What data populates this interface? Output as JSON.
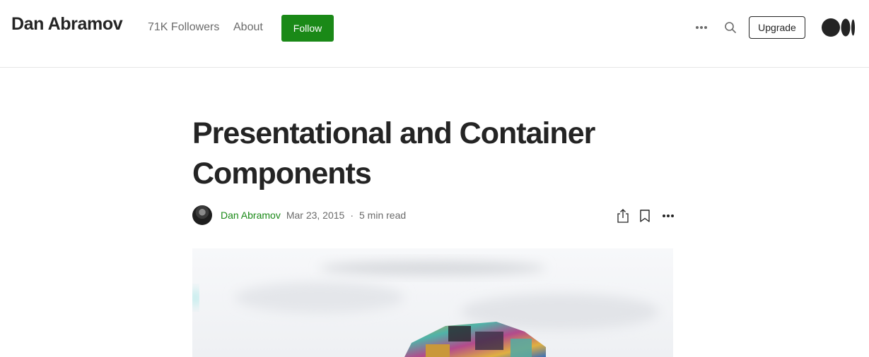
{
  "header": {
    "brand": "Dan Abramov",
    "followers": "71K Followers",
    "about": "About",
    "follow_label": "Follow",
    "more_icon": "more-horizontal-icon",
    "search_icon": "search-icon",
    "upgrade_label": "Upgrade",
    "logo_icon": "medium-logo-icon"
  },
  "article": {
    "title": "Presentational and Container Components",
    "author": "Dan Abramov",
    "date": "Mar 23, 2015",
    "separator": "·",
    "read_time": "5 min read",
    "actions": [
      "share-icon",
      "bookmark-icon",
      "more-options-icon"
    ]
  },
  "colors": {
    "accent": "#1a8917",
    "text": "#242424",
    "muted": "#6b6b6b"
  }
}
